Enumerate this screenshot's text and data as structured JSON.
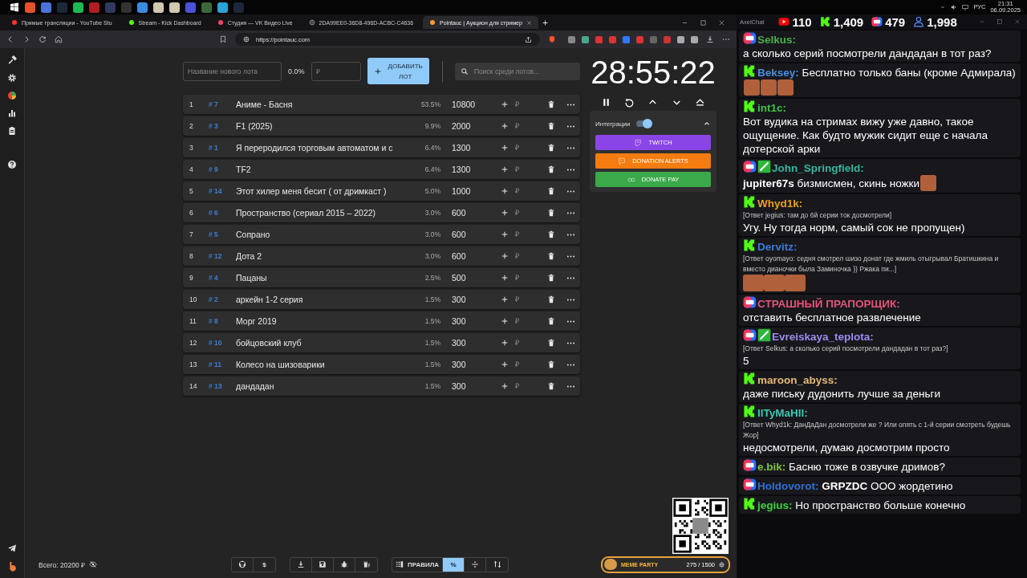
{
  "system_tray": {
    "language": "РУС",
    "time": "21:31",
    "date": "06.09.2025"
  },
  "browser": {
    "tabs": [
      {
        "label": "Прямые трансляции - YouTube Stu",
        "selected": false
      },
      {
        "label": "Stream - Kick Dashboard",
        "selected": false
      },
      {
        "label": "Студия — VK Видео Live",
        "selected": false
      },
      {
        "label": "2DA99EE0-36D8-496D-ACBC-C4636",
        "selected": false
      },
      {
        "label": "Pointauc | Аукцион для стример",
        "selected": true
      }
    ],
    "url": "https://pointauc.com"
  },
  "auction": {
    "new_lot": {
      "placeholder": "Название нового лота"
    },
    "new_lot_percent": "0.0%",
    "new_lot_amount": {
      "placeholder": "₽"
    },
    "add_button": "ДОБАВИТЬ ЛОТ",
    "search": {
      "placeholder": "Поиск среди лотов..."
    },
    "lots": [
      {
        "rank": "1",
        "id": "# 7",
        "name": "Аниме - Басня",
        "percent": "53.5%",
        "amount": "10800",
        "bid_placeholder": "₽"
      },
      {
        "rank": "2",
        "id": "# 3",
        "name": "F1 (2025)",
        "percent": "9.9%",
        "amount": "2000",
        "bid_placeholder": "₽"
      },
      {
        "rank": "3",
        "id": "# 1",
        "name": "Я переродился торговым автоматом и с",
        "percent": "6.4%",
        "amount": "1300",
        "bid_placeholder": "₽"
      },
      {
        "rank": "4",
        "id": "# 9",
        "name": "TF2",
        "percent": "6.4%",
        "amount": "1300",
        "bid_placeholder": "₽"
      },
      {
        "rank": "5",
        "id": "# 14",
        "name": "Этот хилер меня бесит ( от дримкаст )",
        "percent": "5.0%",
        "amount": "1000",
        "bid_placeholder": "₽"
      },
      {
        "rank": "6",
        "id": "# 6",
        "name": "Пространство (сериал 2015 – 2022)",
        "percent": "3.0%",
        "amount": "600",
        "bid_placeholder": "₽"
      },
      {
        "rank": "7",
        "id": "# 5",
        "name": "Сопрано",
        "percent": "3.0%",
        "amount": "600",
        "bid_placeholder": "₽"
      },
      {
        "rank": "8",
        "id": "# 12",
        "name": "Дота 2",
        "percent": "3.0%",
        "amount": "600",
        "bid_placeholder": "₽"
      },
      {
        "rank": "9",
        "id": "# 4",
        "name": "Пацаны",
        "percent": "2.5%",
        "amount": "500",
        "bid_placeholder": "₽"
      },
      {
        "rank": "10",
        "id": "# 2",
        "name": "аркейн 1-2 серия",
        "percent": "1.5%",
        "amount": "300",
        "bid_placeholder": "₽"
      },
      {
        "rank": "11",
        "id": "# 8",
        "name": "Морг 2019",
        "percent": "1.5%",
        "amount": "300",
        "bid_placeholder": "₽"
      },
      {
        "rank": "12",
        "id": "# 10",
        "name": "бойцовский клуб",
        "percent": "1.5%",
        "amount": "300",
        "bid_placeholder": "₽"
      },
      {
        "rank": "13",
        "id": "# 11",
        "name": "Колесо на шизоварики",
        "percent": "1.5%",
        "amount": "300",
        "bid_placeholder": "₽"
      },
      {
        "rank": "14",
        "id": "# 13",
        "name": "дандадан",
        "percent": "1.5%",
        "amount": "300",
        "bid_placeholder": "₽"
      }
    ],
    "timer": "28:55:22",
    "integrations": {
      "label": "Интеграции",
      "on": true,
      "expanded": true,
      "buttons": [
        {
          "label": "TWITCH",
          "kind": "twitch"
        },
        {
          "label": "DONATION ALERTS",
          "kind": "donationalerts"
        },
        {
          "label": "DONATE PAY",
          "kind": "donatepay"
        }
      ]
    },
    "total": "Всего: 20200 ₽",
    "toolbar_groups": [
      {
        "buttons": [
          {
            "kind": "github"
          },
          {
            "kind": "text",
            "label": "$"
          }
        ]
      },
      {
        "buttons": [
          {
            "kind": "download"
          },
          {
            "kind": "save"
          },
          {
            "kind": "bug"
          },
          {
            "kind": "clear"
          }
        ]
      },
      {
        "buttons": [
          {
            "kind": "rules",
            "label": "ПРАВИЛА",
            "selected": false
          },
          {
            "kind": "text",
            "label": "%",
            "selected": true
          },
          {
            "kind": "divide",
            "selected": false
          },
          {
            "kind": "sort",
            "selected": false
          }
        ]
      }
    ],
    "meme_party": {
      "title": "MEME PARTY",
      "count": "275 / 1500"
    }
  },
  "chat": {
    "title": "AxelChat",
    "stats": [
      {
        "kind": "youtube",
        "value": "110"
      },
      {
        "kind": "kick",
        "value": "1,409"
      },
      {
        "kind": "vk",
        "value": "479"
      },
      {
        "kind": "viewers",
        "value": "1,998"
      }
    ],
    "messages": [
      {
        "kind": "vk",
        "moderator": false,
        "author": "Selkus:",
        "color": "#4cae4c",
        "text": "а сколько серий посмотрели дандадан в тот раз?"
      },
      {
        "kind": "kick",
        "moderator": false,
        "author": "Beksey:",
        "color": "#4a8fe0",
        "text": "Бесплатно только баны (кроме Адмирала)",
        "emotes": [
          {
            "kind": "emote"
          },
          {
            "kind": "emote"
          },
          {
            "kind": "emote"
          }
        ]
      },
      {
        "kind": "kick",
        "moderator": false,
        "author": "int1c:",
        "color": "#3ec24a",
        "text": "Вот вудика на стримах вижу уже давно, такое ощущение. Как будто мужик сидит еще с начала дотерской арки"
      },
      {
        "kind": "vk",
        "moderator": true,
        "author": "John_Springfield:",
        "color": "#35b5a0",
        "text": "**jupiter67s** бизмисмен, скинь ножки",
        "emotes": [
          {
            "kind": "emote"
          }
        ]
      },
      {
        "kind": "kick",
        "moderator": false,
        "author": "Whyd1k:",
        "color": "#e8a020",
        "reply": "[Ответ jegius: там до 6й серии ток досмотрели]",
        "text": "Угу. Ну тогда норм, самый сок не пропущен)"
      },
      {
        "kind": "kick",
        "moderator": false,
        "author": "Dervitz:",
        "color": "#3a7be0",
        "reply": "[Ответ oyomayo: седня смотрел шизо донат где жмиль отыгрывал Братишкина и вместо дианочки была Заминочка )) Ржака пи...]",
        "emotes": [
          {
            "kind": "emote"
          },
          {
            "kind": "emote"
          },
          {
            "kind": "emote"
          }
        ]
      },
      {
        "kind": "vk",
        "moderator": false,
        "author": "СТРАШНЫЙ ПРАПОРЩИК:",
        "color": "#e0557a",
        "text": "отставить бесплатное развлечение"
      },
      {
        "kind": "vk",
        "moderator": true,
        "author": "Evreiskaya_teplota:",
        "color": "#9b8cf0",
        "reply": "[Ответ Selkus: а сколько серий посмотрели дандадан в тот раз?]",
        "text": "5"
      },
      {
        "kind": "kick",
        "moderator": false,
        "author": "maroon_abyss:",
        "color": "#e6b87a",
        "text": "даже письку дудонить лучше за деньги"
      },
      {
        "kind": "kick",
        "moderator": false,
        "author": "IlTyMaHIl:",
        "color": "#3cc8b4",
        "reply": "[Ответ Whyd1k: ДанДаДан досмотрели же ? Или опять с 1-й серии смотреть будешь Жор]",
        "text": "недосмотрели, думаю досмотрим просто"
      },
      {
        "kind": "vk",
        "moderator": false,
        "author": "e.bik:",
        "color": "#7cc142",
        "text": "Басню тоже в озвучке дримов?"
      },
      {
        "kind": "vk",
        "moderator": false,
        "author": "Holdovorot:",
        "color": "#2f6fd6",
        "text": "**GRPZDC** ООО жордетино"
      },
      {
        "kind": "kick",
        "moderator": false,
        "author": "jegius:",
        "color": "#40d040",
        "text": "Но пространство больше конечно"
      }
    ]
  }
}
